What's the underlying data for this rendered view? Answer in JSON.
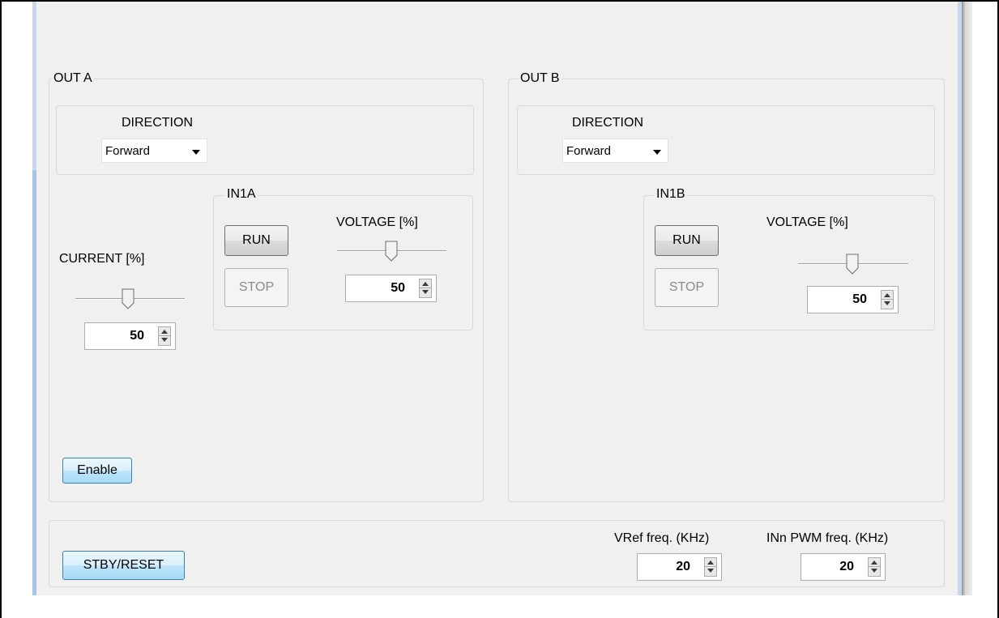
{
  "out_a": {
    "title": "OUT A",
    "direction": {
      "label": "DIRECTION",
      "value": "Forward"
    },
    "current": {
      "label": "CURRENT [%]",
      "value": "50",
      "level_percent": 50
    },
    "in1": {
      "title": "IN1A",
      "run_label": "RUN",
      "stop_label": "STOP",
      "voltage": {
        "label": "VOLTAGE [%]",
        "value": "50",
        "level_percent": 50
      }
    },
    "enable_label": "Enable"
  },
  "out_b": {
    "title": "OUT B",
    "direction": {
      "label": "DIRECTION",
      "value": "Forward"
    },
    "in1": {
      "title": "IN1B",
      "run_label": "RUN",
      "stop_label": "STOP",
      "voltage": {
        "label": "VOLTAGE [%]",
        "value": "50",
        "level_percent": 50
      }
    }
  },
  "bottom": {
    "stby_label": "STBY/RESET",
    "vref": {
      "label": "VRef freq. (KHz)",
      "value": "20"
    },
    "pwm": {
      "label": "INn PWM freq. (KHz)",
      "value": "20"
    }
  }
}
